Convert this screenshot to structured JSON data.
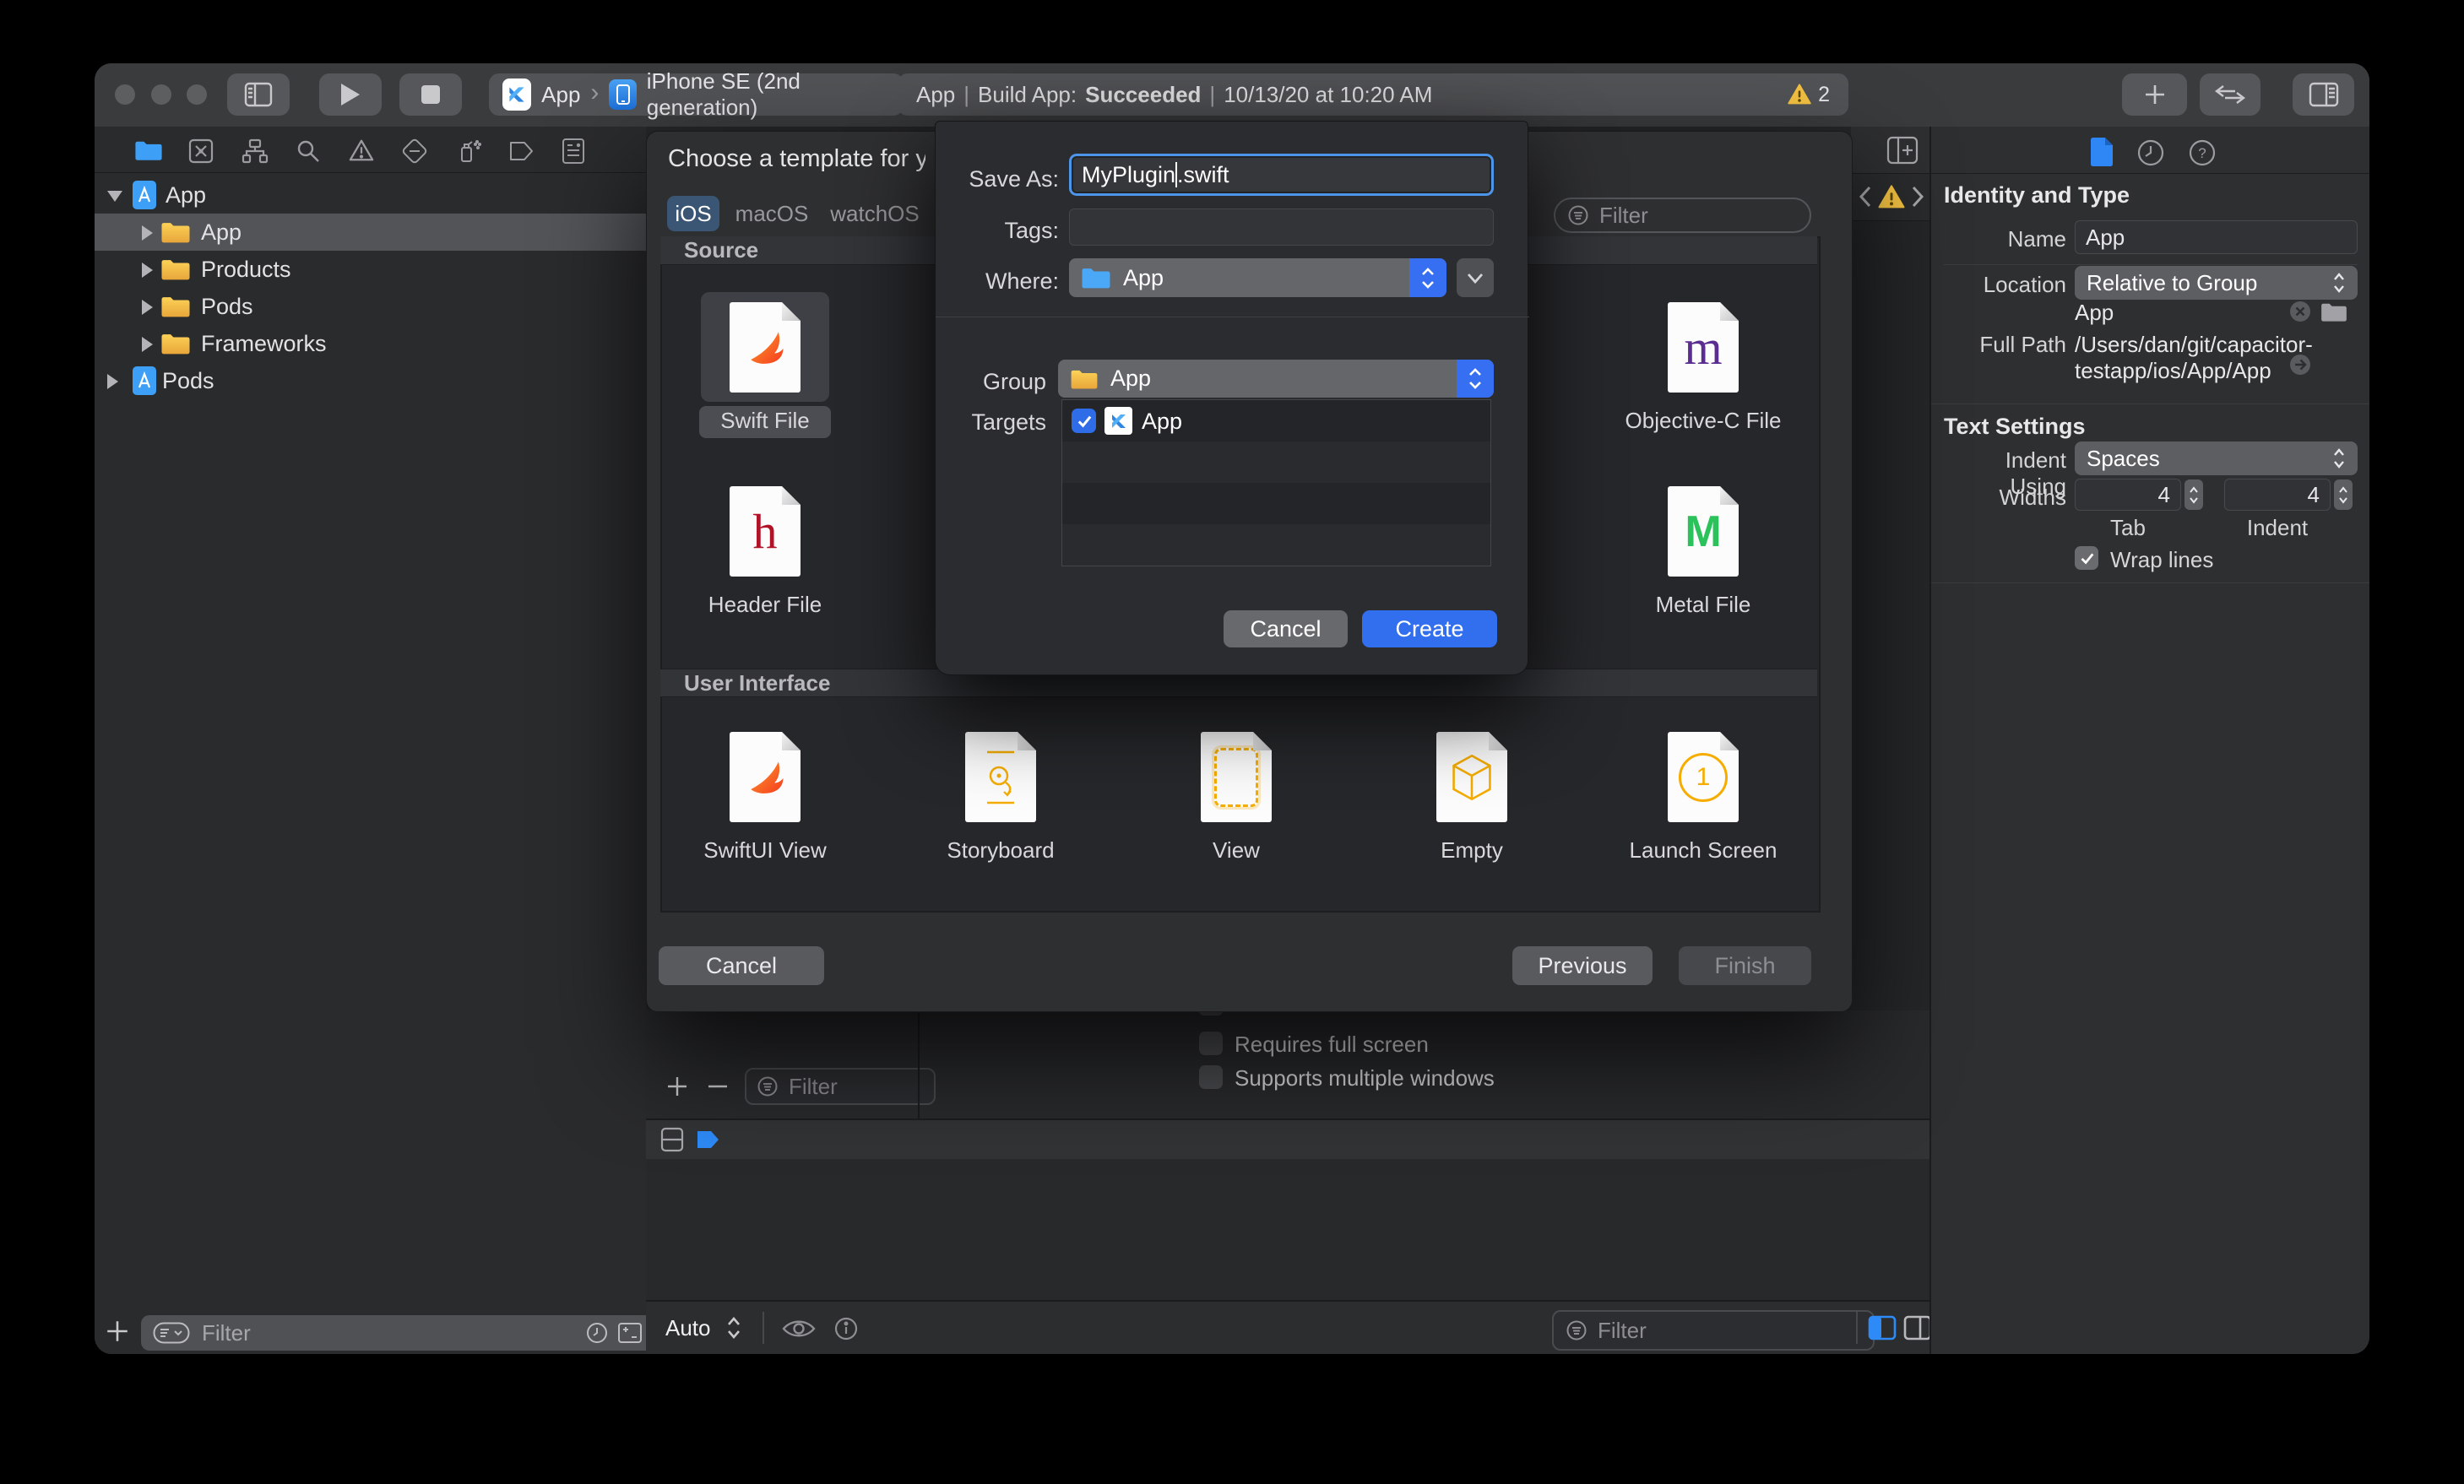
{
  "toolbar": {
    "scheme_project": "App",
    "scheme_destination": "iPhone SE (2nd generation)",
    "status_app": "App",
    "status_separator": "|",
    "status_action": "Build App:",
    "status_result": "Succeeded",
    "status_time": "10/13/20 at 10:20 AM",
    "warning_count": "2"
  },
  "navigator": {
    "project_row": "App",
    "children": [
      "App",
      "Products",
      "Pods",
      "Frameworks"
    ],
    "pods_row": "Pods",
    "filter_placeholder": "Filter"
  },
  "template_dialog": {
    "title": "Choose a template for your",
    "tabs": [
      "iOS",
      "macOS",
      "watchOS"
    ],
    "filter_placeholder": "Filter",
    "source_title": "Source",
    "source_items": [
      "Swift File",
      "Header File",
      "Objective-C File",
      "Metal File"
    ],
    "ui_title": "User Interface",
    "ui_items": [
      "SwiftUI View",
      "Storyboard",
      "View",
      "Empty",
      "Launch Screen"
    ],
    "glyph_header": "h",
    "glyph_objc": "m",
    "glyph_metal": "M",
    "glyph_launch": "1",
    "cancel": "Cancel",
    "previous": "Previous",
    "finish": "Finish"
  },
  "save_sheet": {
    "save_as_label": "Save As:",
    "filename_before_cursor": "MyPlugin",
    "filename_after_cursor": ".swift",
    "tags_label": "Tags:",
    "where_label": "Where:",
    "where_value": "App",
    "group_label": "Group",
    "group_value": "App",
    "targets_label": "Targets",
    "target_name": "App",
    "cancel": "Cancel",
    "create": "Create"
  },
  "editor_settings": {
    "option1": "Requires full screen",
    "option2": "Supports multiple windows",
    "filter_placeholder": "Filter"
  },
  "debug_area": {
    "auto_label": "Auto",
    "filter_placeholder": "Filter"
  },
  "inspector": {
    "identity_title": "Identity and Type",
    "name_label": "Name",
    "name_value": "App",
    "location_label": "Location",
    "location_value": "Relative to Group",
    "location_group": "App",
    "full_path_label": "Full Path",
    "full_path_line1": "/Users/dan/git/capacitor-",
    "full_path_line2": "testapp/ios/App/App",
    "text_title": "Text Settings",
    "indent_label": "Indent Using",
    "indent_value": "Spaces",
    "widths_label": "Widths",
    "tab_width": "4",
    "tab_label": "Tab",
    "indent_width": "4",
    "indent_width_label": "Indent",
    "wrap_label": "Wrap lines"
  }
}
